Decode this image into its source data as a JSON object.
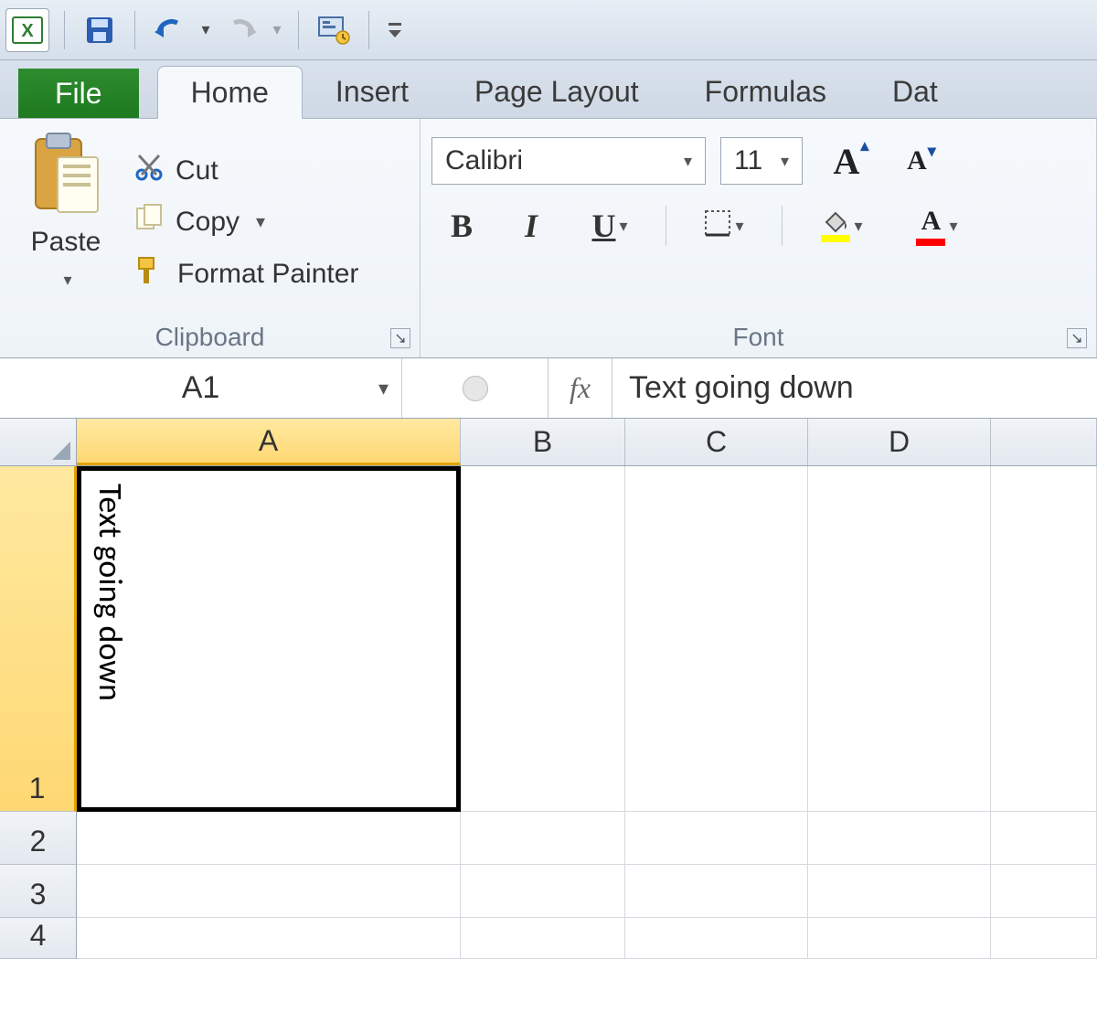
{
  "qat": {
    "undo_tip": "Undo",
    "redo_tip": "Redo",
    "save_tip": "Save"
  },
  "tabs": {
    "file": "File",
    "home": "Home",
    "insert": "Insert",
    "page_layout": "Page Layout",
    "formulas": "Formulas",
    "data": "Dat"
  },
  "ribbon": {
    "clipboard": {
      "label": "Clipboard",
      "paste": "Paste",
      "cut": "Cut",
      "copy": "Copy",
      "format_painter": "Format Painter"
    },
    "font": {
      "label": "Font",
      "font_name": "Calibri",
      "font_size": "11",
      "bold": "B",
      "italic": "I",
      "underline": "U",
      "increase_a": "A",
      "decrease_a": "A",
      "font_color_a": "A"
    }
  },
  "formula_bar": {
    "name_box": "A1",
    "fx": "fx",
    "formula": "Text going down"
  },
  "grid": {
    "columns": [
      "A",
      "B",
      "C",
      "D"
    ],
    "rows": [
      "1",
      "2",
      "3",
      "4"
    ],
    "a1_value": "Text going down"
  }
}
